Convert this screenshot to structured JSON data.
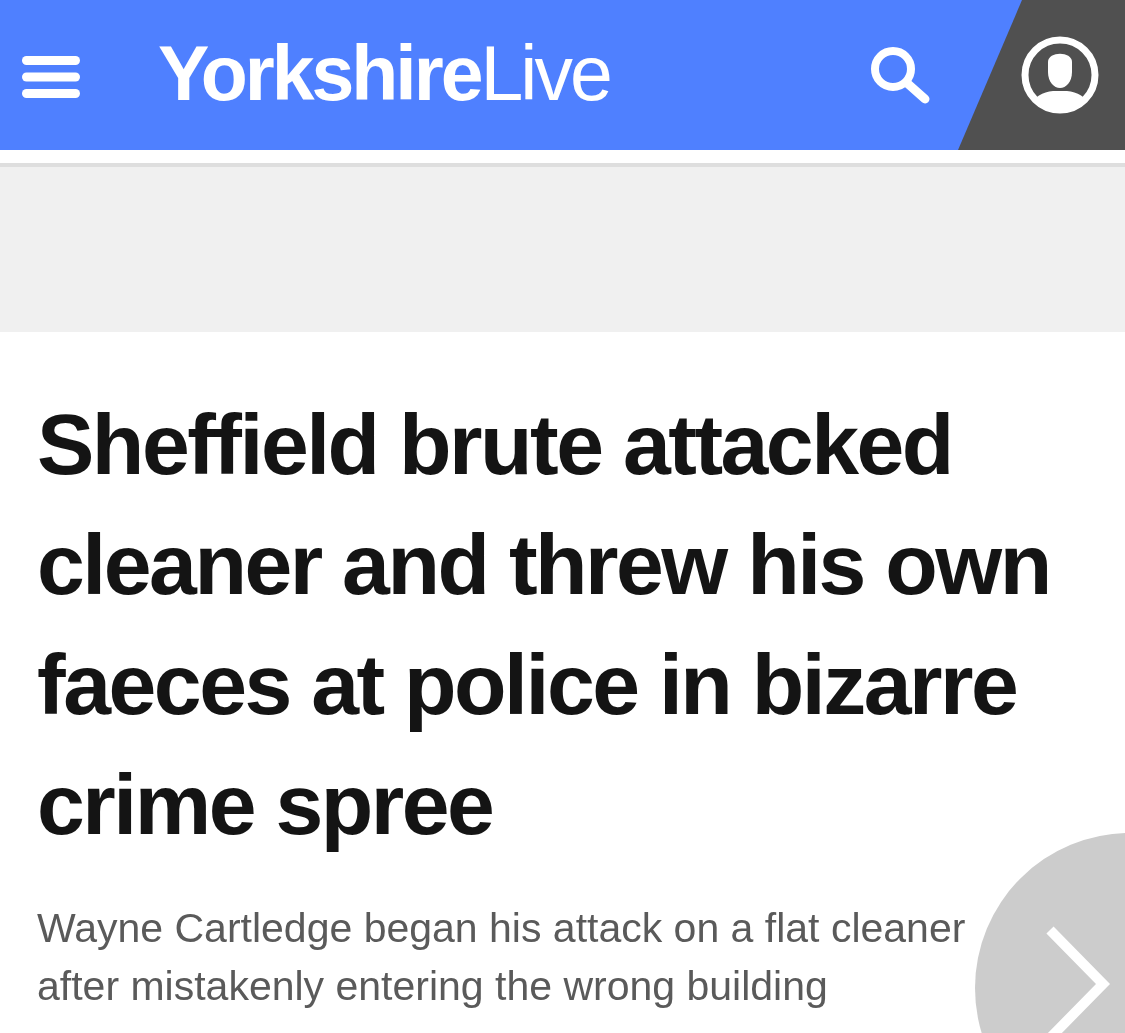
{
  "header": {
    "logo": "**Yorkshire**Live"
  },
  "article": {
    "headline": "Sheffield brute attacked cleaner and threw his own faeces at police in bizarre crime spree",
    "standfirst": "Wayne Cartledge began his attack on a flat cleaner after mistakenly entering the wrong building"
  }
}
